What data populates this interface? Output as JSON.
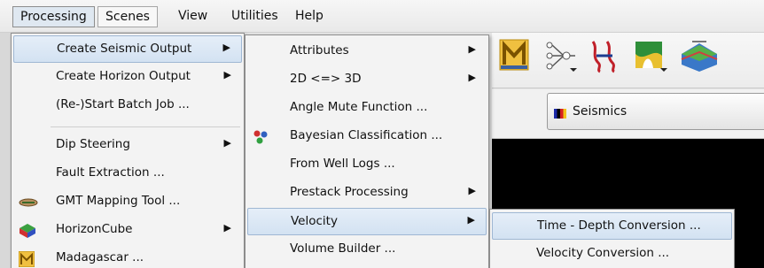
{
  "menubar": {
    "items": [
      "Processing",
      "Scenes",
      "View",
      "Utilities",
      "Help"
    ]
  },
  "combo": {
    "label": "Seismics"
  },
  "toolbar_icons": [
    "madagascar-icon",
    "attribute-network-icon",
    "fault-split-icon",
    "horizon-color-icon",
    "stratigraphy-icon"
  ],
  "processing_menu": {
    "items": [
      {
        "label": "Create Seismic Output",
        "submenu": true,
        "highlighted": true
      },
      {
        "label": "Create Horizon Output",
        "submenu": true
      },
      {
        "label": "(Re-)Start Batch Job ...",
        "submenu": false
      },
      {
        "label": "Dip Steering",
        "submenu": true
      },
      {
        "label": "Fault Extraction ...",
        "submenu": false
      },
      {
        "label": "GMT Mapping Tool ...",
        "submenu": false,
        "icon": "gmt-icon"
      },
      {
        "label": "HorizonCube",
        "submenu": true,
        "icon": "horizoncube-icon"
      },
      {
        "label": "Madagascar ...",
        "submenu": false,
        "icon": "madagascar-icon"
      }
    ]
  },
  "seismic_output_menu": {
    "items": [
      {
        "label": "Attributes",
        "submenu": true
      },
      {
        "label": "2D <=> 3D",
        "submenu": true
      },
      {
        "label": "Angle Mute Function ...",
        "submenu": false
      },
      {
        "label": "Bayesian Classification ...",
        "submenu": false,
        "icon": "bayesian-icon"
      },
      {
        "label": "From Well Logs ...",
        "submenu": false
      },
      {
        "label": "Prestack Processing",
        "submenu": true
      },
      {
        "label": "Velocity",
        "submenu": true,
        "highlighted": true
      },
      {
        "label": "Volume Builder ...",
        "submenu": false
      }
    ]
  },
  "velocity_menu": {
    "items": [
      {
        "label": "Time - Depth Conversion ...",
        "highlighted": true
      },
      {
        "label": "Velocity Conversion ..."
      }
    ]
  },
  "submenu_arrow": "▶"
}
